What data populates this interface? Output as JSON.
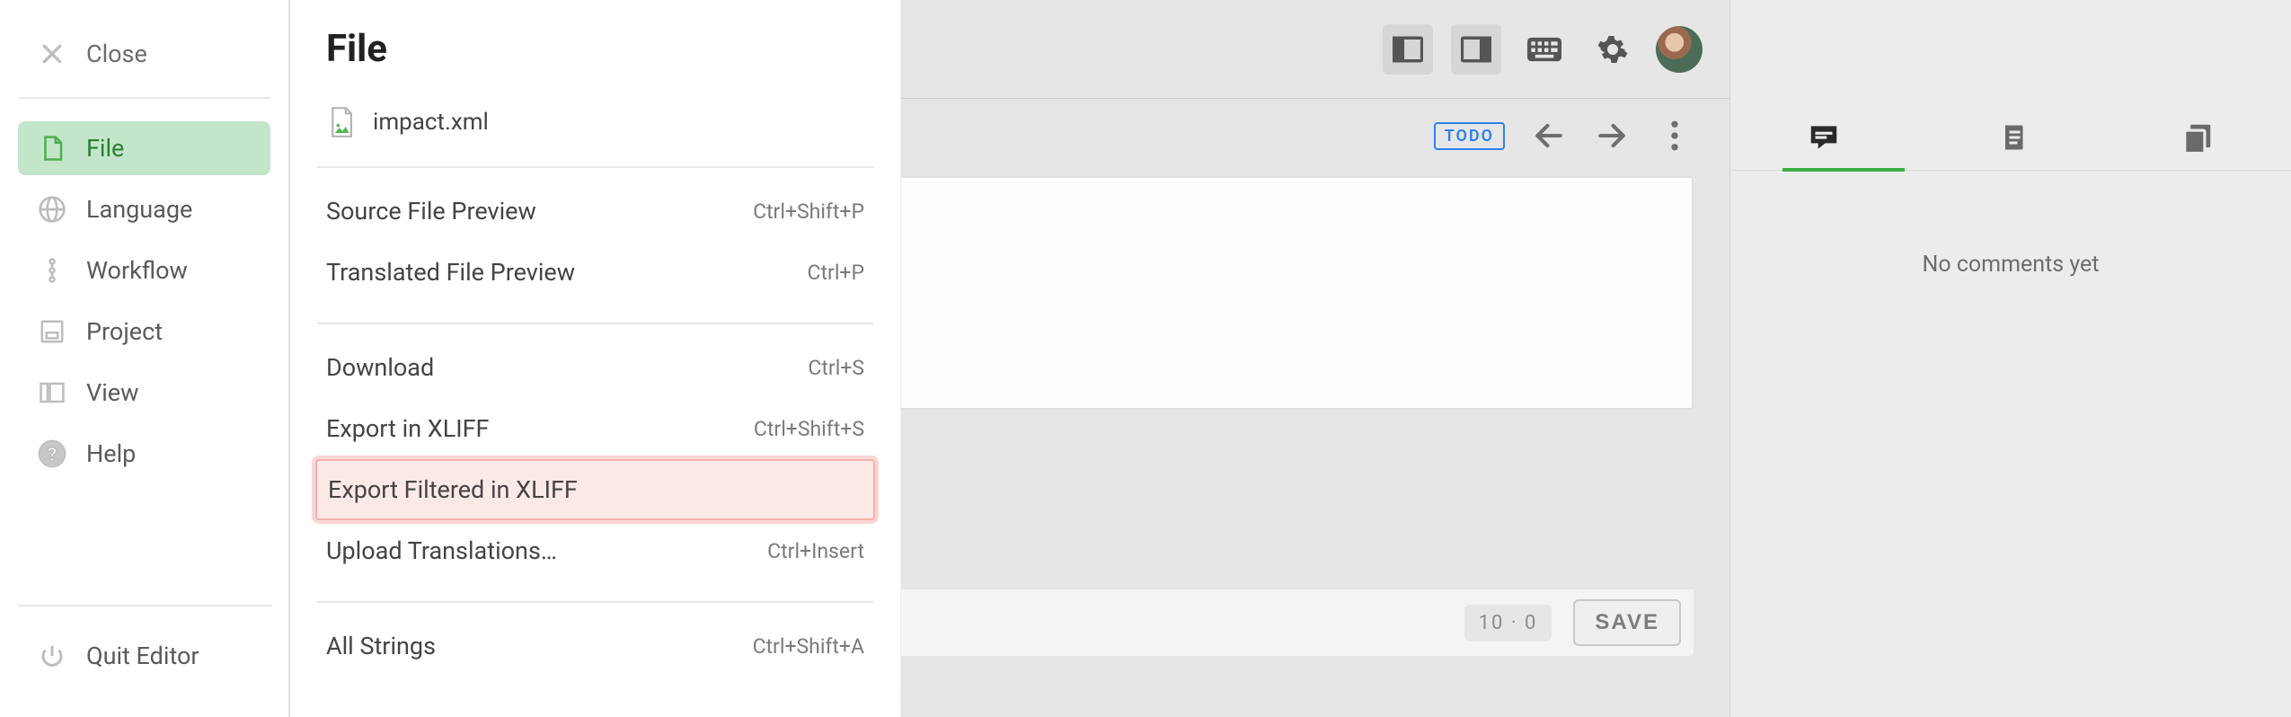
{
  "sidebar": {
    "close": "Close",
    "items": [
      {
        "label": "File"
      },
      {
        "label": "Language"
      },
      {
        "label": "Workflow"
      },
      {
        "label": "Project"
      },
      {
        "label": "View"
      },
      {
        "label": "Help"
      }
    ],
    "quit": "Quit Editor"
  },
  "menu": {
    "title": "File",
    "current_file": "impact.xml",
    "group1": [
      {
        "label": "Source File Preview",
        "shortcut": "Ctrl+Shift+P"
      },
      {
        "label": "Translated File Preview",
        "shortcut": "Ctrl+P"
      }
    ],
    "group2": [
      {
        "label": "Download",
        "shortcut": "Ctrl+S"
      },
      {
        "label": "Export in XLIFF",
        "shortcut": "Ctrl+Shift+S"
      },
      {
        "label": "Export Filtered in XLIFF",
        "shortcut": ""
      },
      {
        "label": "Upload Translations…",
        "shortcut": "Ctrl+Insert"
      }
    ],
    "group3": [
      {
        "label": "All Strings",
        "shortcut": "Ctrl+Shift+A"
      }
    ]
  },
  "segment": {
    "todo_badge": "TODO",
    "counter": "10 · 0",
    "save_label": "SAVE"
  },
  "rightpanel": {
    "empty_text": "No comments yet"
  }
}
